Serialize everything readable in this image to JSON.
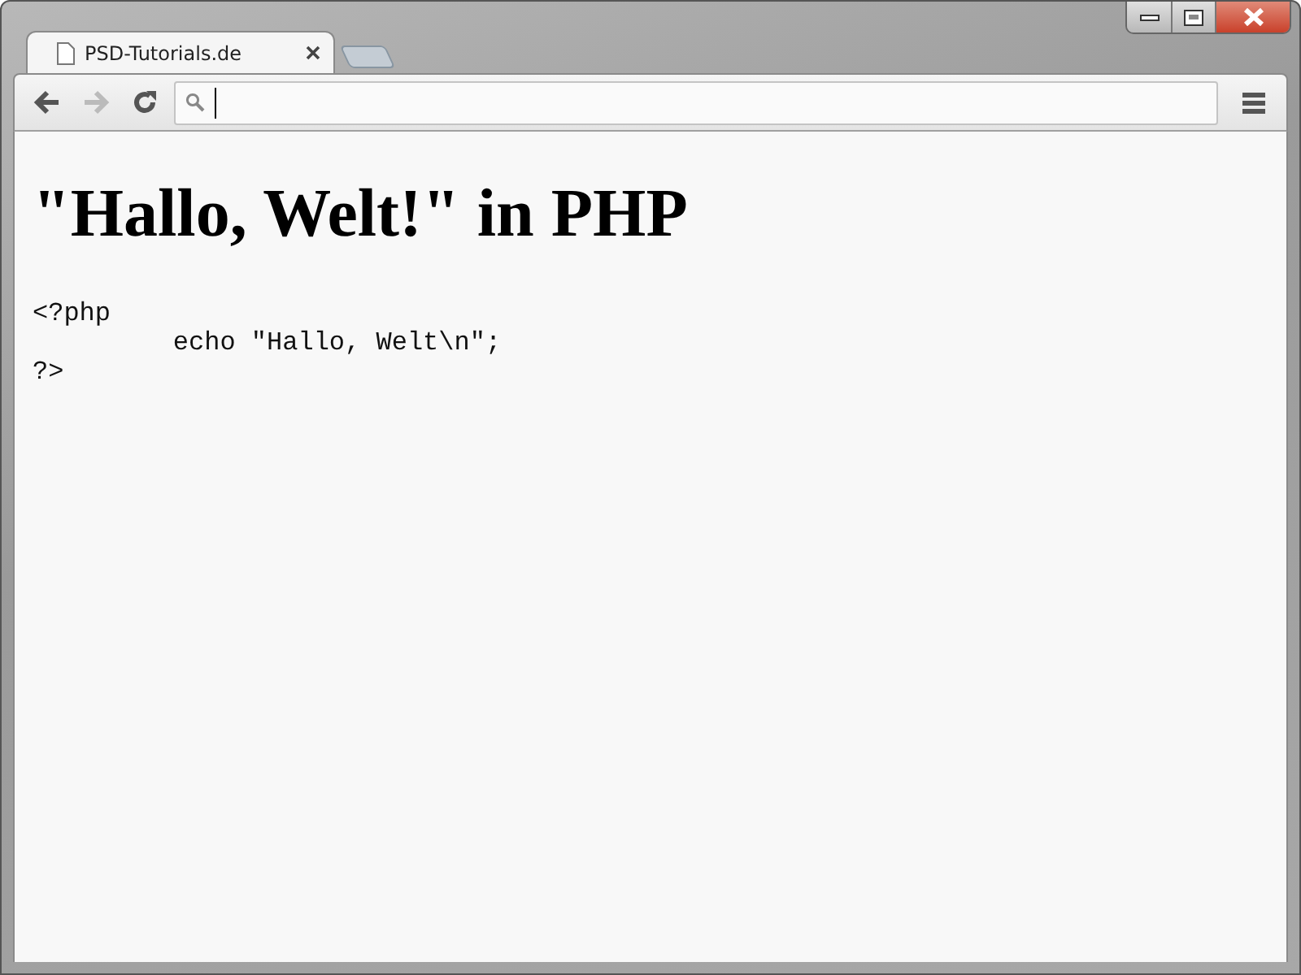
{
  "tabs": [
    {
      "title": "PSD-Tutorials.de",
      "selected": true
    }
  ],
  "toolbar": {
    "back_disabled": false,
    "forward_disabled": true
  },
  "page": {
    "heading": "\"Hallo, Welt!\" in PHP",
    "code_lines": [
      "<?php",
      "         echo \"Hallo, Welt\\n\";",
      "?>"
    ]
  }
}
